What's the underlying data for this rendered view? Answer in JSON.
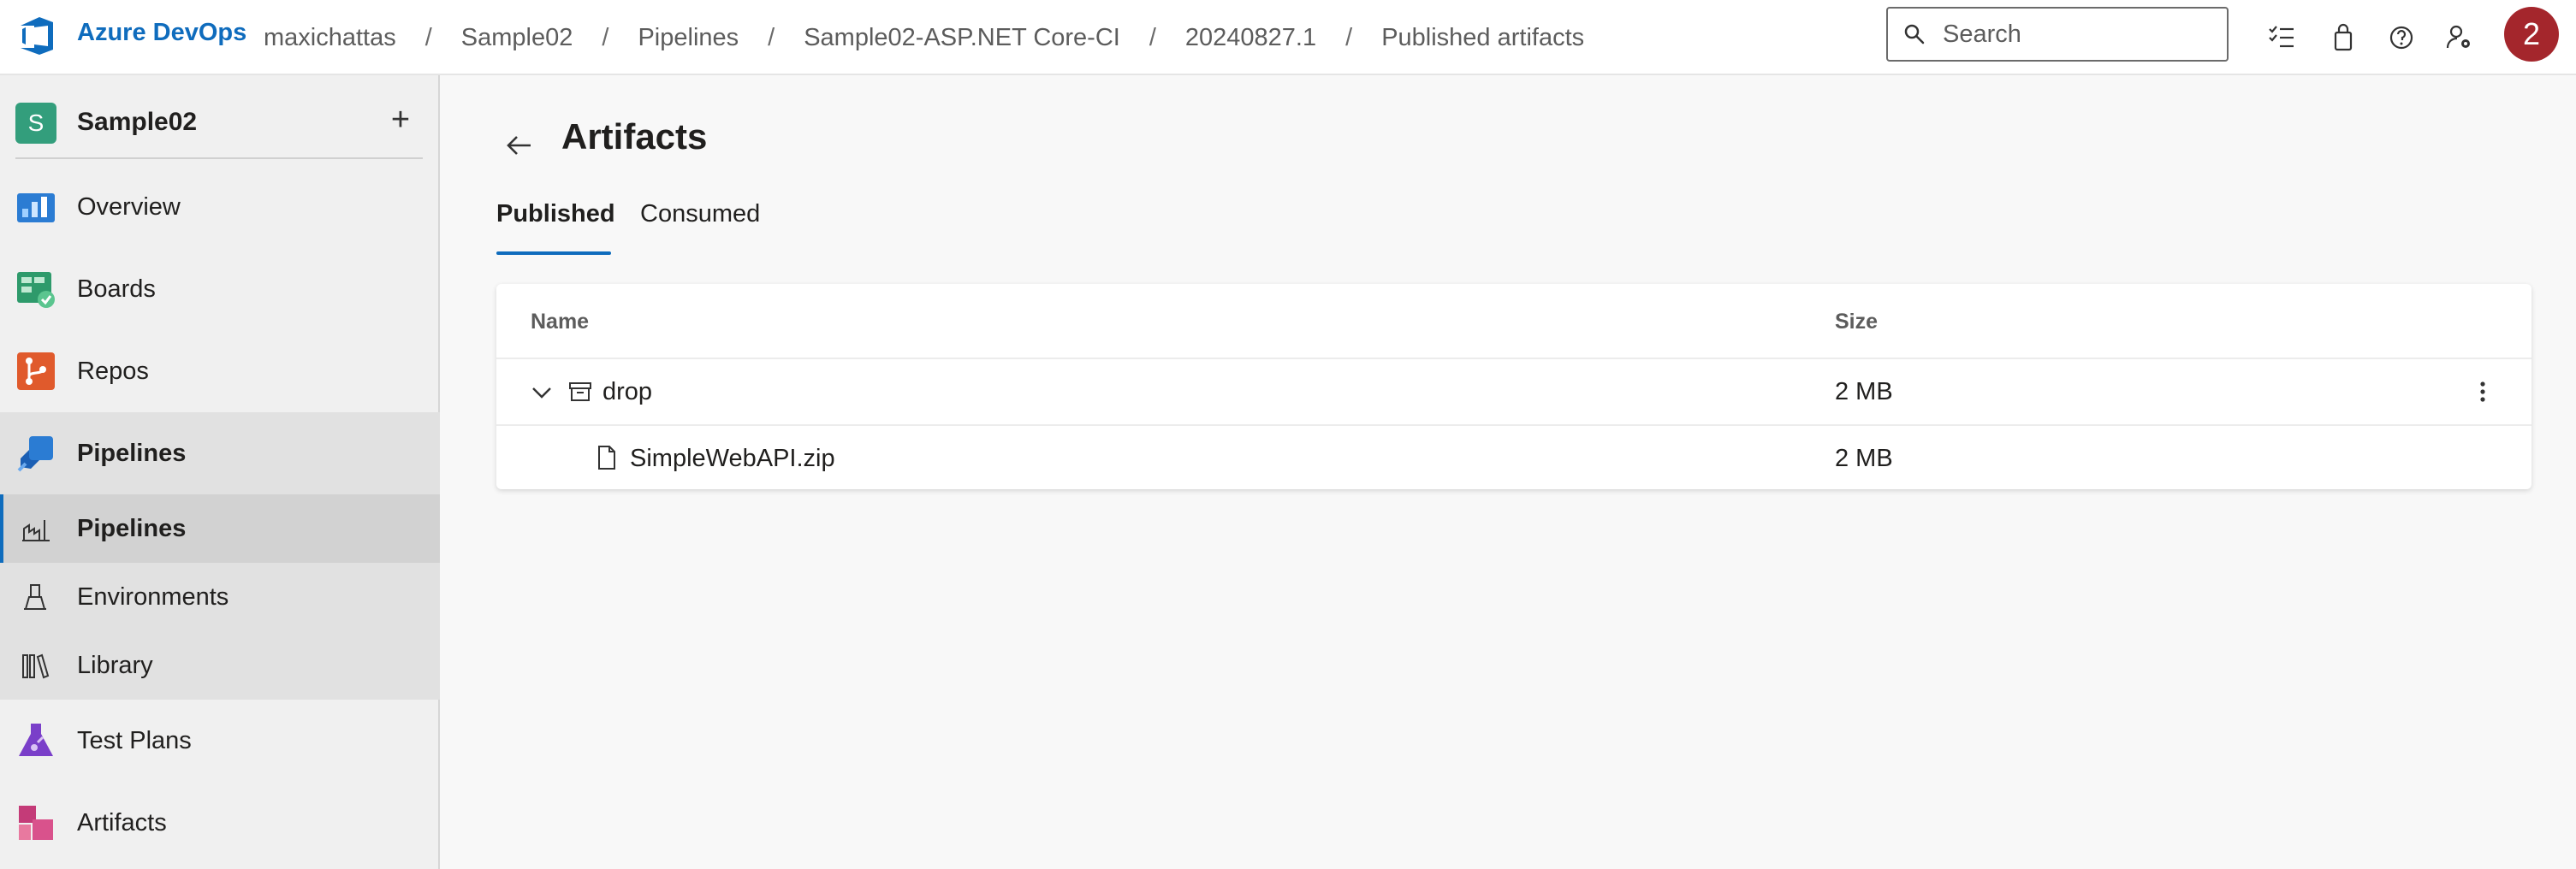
{
  "header": {
    "brand": "Azure DevOps",
    "breadcrumbs": [
      "maxichattas",
      "Sample02",
      "Pipelines",
      "Sample02-ASP.NET Core-CI",
      "20240827.1",
      "Published artifacts"
    ],
    "separator": "/",
    "search_placeholder": "Search",
    "avatar_text": "2",
    "icons": [
      "search-icon",
      "task-list-icon",
      "shopping-bag-icon",
      "help-icon",
      "user-settings-icon"
    ]
  },
  "sidebar": {
    "project_initial": "S",
    "project_name": "Sample02",
    "add_label": "+",
    "items": [
      {
        "label": "Overview",
        "icon": "overview-icon"
      },
      {
        "label": "Boards",
        "icon": "boards-icon"
      },
      {
        "label": "Repos",
        "icon": "repos-icon"
      },
      {
        "label": "Pipelines",
        "icon": "pipelines-icon"
      },
      {
        "label": "Test Plans",
        "icon": "test-plans-icon"
      },
      {
        "label": "Artifacts",
        "icon": "artifacts-icon"
      }
    ],
    "sub_items": [
      {
        "label": "Pipelines",
        "icon": "pipelines-sub-icon"
      },
      {
        "label": "Environments",
        "icon": "environments-icon"
      },
      {
        "label": "Library",
        "icon": "library-icon"
      }
    ]
  },
  "main": {
    "title": "Artifacts",
    "tabs": [
      {
        "label": "Published",
        "selected": true
      },
      {
        "label": "Consumed",
        "selected": false
      }
    ],
    "table": {
      "columns": [
        "Name",
        "Size"
      ],
      "rows": [
        {
          "name": "drop",
          "size": "2 MB",
          "type": "folder",
          "expanded": true
        },
        {
          "name": "SimpleWebAPI.zip",
          "size": "2 MB",
          "type": "file"
        }
      ]
    }
  },
  "colors": {
    "accent": "#0f6cbd",
    "avatar_bg": "#a4262c",
    "project_badge": "#339e7c"
  }
}
